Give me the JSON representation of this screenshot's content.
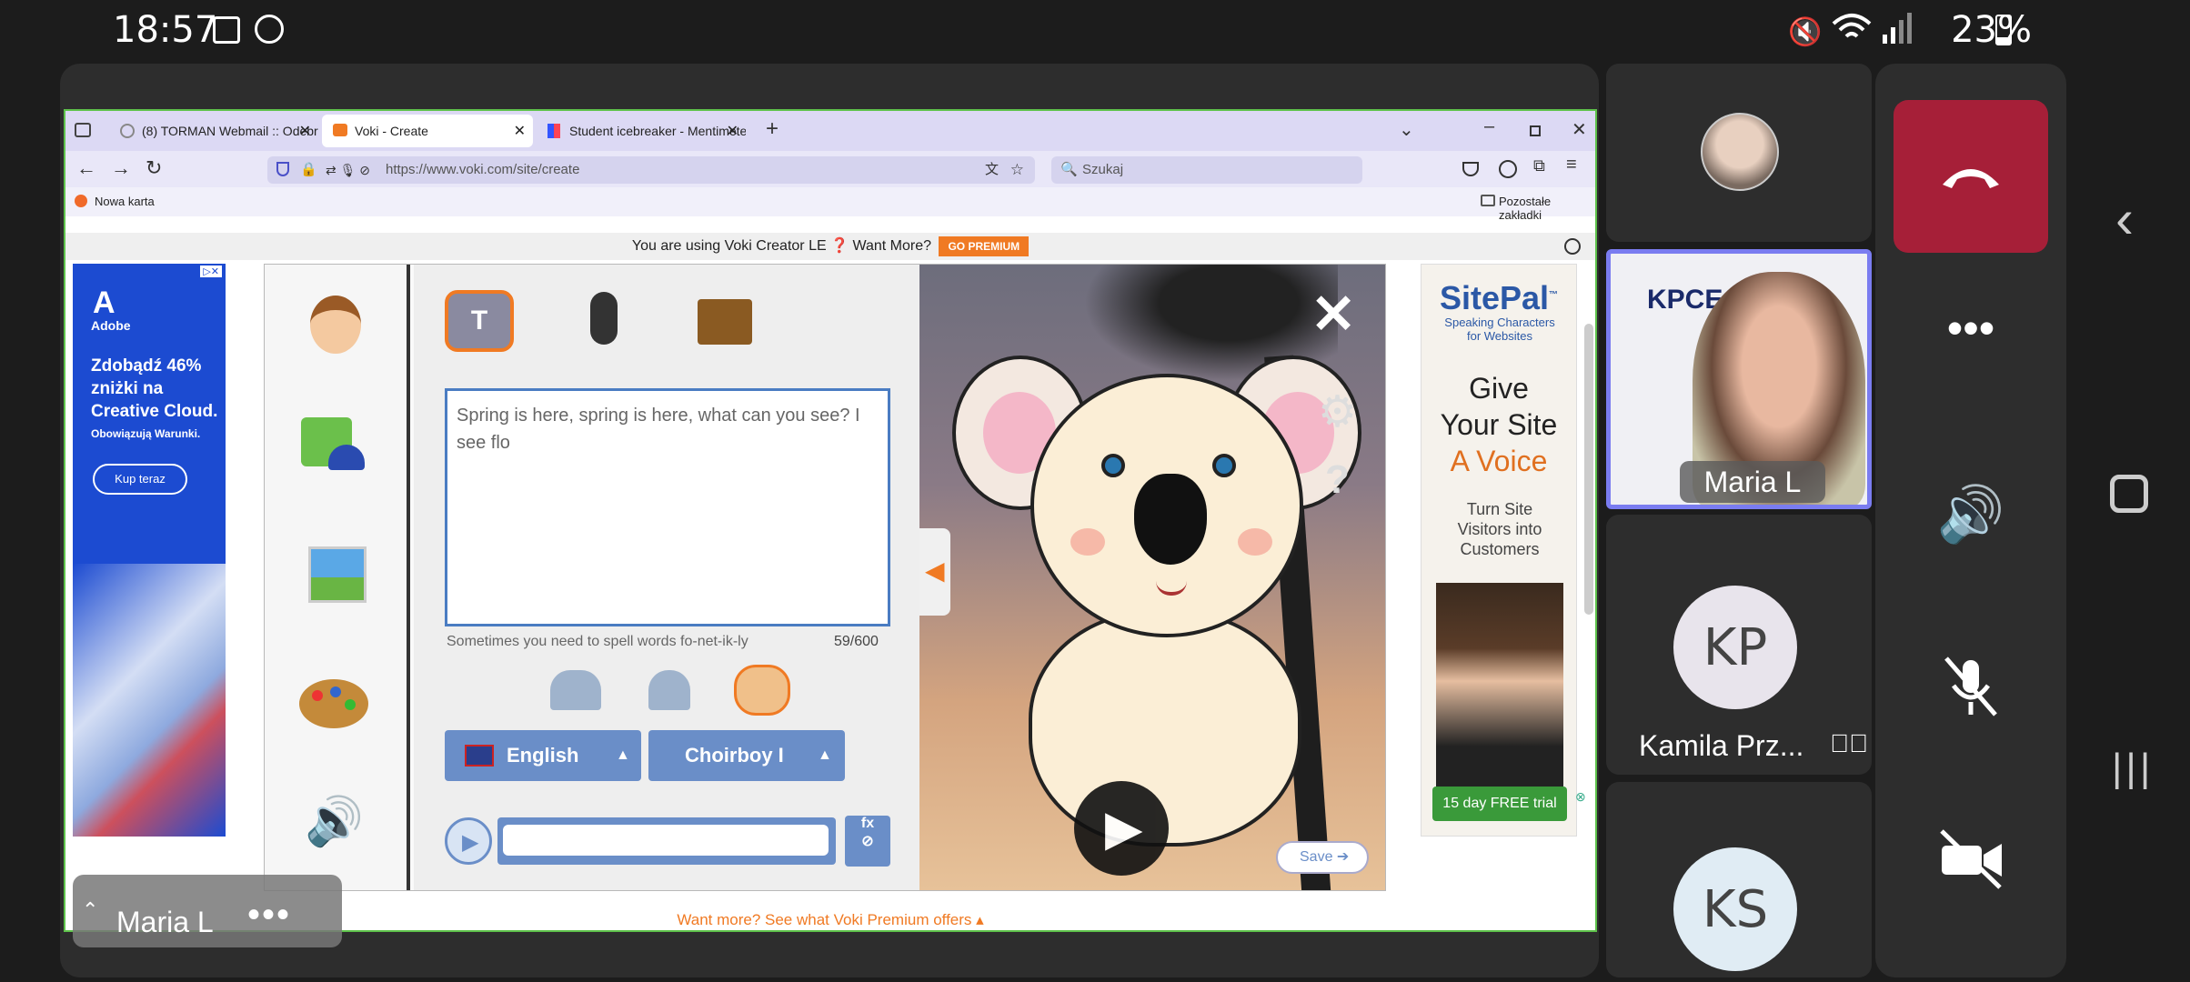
{
  "status": {
    "time": "18:57",
    "battery": "23%"
  },
  "browser": {
    "tabs": [
      {
        "label": "(8) TORMAN Webmail :: Odebr"
      },
      {
        "label": "Voki - Create"
      },
      {
        "label": "Student icebreaker - Mentimete"
      }
    ],
    "url": "https://www.voki.com/site/create",
    "search_placeholder": "Szukaj",
    "bookmark_new": "Nowa karta",
    "bookmark_other": "Pozostałe zakładki"
  },
  "voki": {
    "banner_text": "You are using Voki Creator LE ❓ Want More?",
    "premium_label": "GO PREMIUM",
    "text_content": "Spring is here, spring is here, what can you see? I see flo",
    "hint": "Sometimes you need to spell words fo-net-ik-ly",
    "counter": "59/600",
    "language": "English",
    "voice": "Choirboy I",
    "fx_label": "fx",
    "save_label": "Save",
    "footer": "Want more? See what Voki Premium offers ▴"
  },
  "ad_left": {
    "brand": "Adobe",
    "headline": "Zdobądź 46% zniżki na Creative Cloud.",
    "sub": "Obowiązują Warunki.",
    "cta": "Kup teraz"
  },
  "ad_right": {
    "brand": "SitePal",
    "tm": "™",
    "tagline": "Speaking Characters for Websites",
    "give": "Give",
    "your_site": "Your Site",
    "a_voice": "A Voice",
    "turn": "Turn Site Visitors into Customers",
    "trial": "15 day FREE trial"
  },
  "presenter": {
    "name": "Maria L"
  },
  "participants": [
    {
      "name": "Maria L",
      "initials": ""
    },
    {
      "name": "Kamila Prz...",
      "initials": "KP"
    },
    {
      "name": "",
      "initials": "KS"
    }
  ],
  "tile_logo": "KPCE",
  "colors": {
    "end_call": "#a61f38",
    "accent_border": "#5ec24b",
    "voki_orange": "#f07a23"
  }
}
